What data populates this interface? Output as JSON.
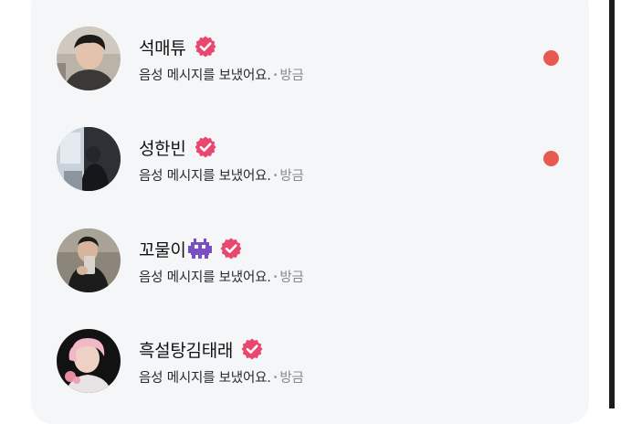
{
  "colors": {
    "panel_bg": "#f5f6f8",
    "verified_badge": "#e8486f",
    "unread_dot": "#e85a4f",
    "name_text": "#111111",
    "message_text": "#2a2a2a",
    "time_text": "#8a8a8a"
  },
  "conversations": [
    {
      "name": "석매튜",
      "verified": true,
      "message": "음성 메시지를 보냈어요.",
      "separator": "•",
      "time": "방금",
      "unread": true,
      "avatar_icon": "profile-photo-icon"
    },
    {
      "name": "성한빈",
      "verified": true,
      "message": "음성 메시지를 보냈어요.",
      "separator": "•",
      "time": "방금",
      "unread": true,
      "avatar_icon": "profile-photo-icon"
    },
    {
      "name": "꼬물이",
      "emoji": "alien-monster-emoji",
      "verified": true,
      "message": "음성 메시지를 보냈어요.",
      "separator": "•",
      "time": "방금",
      "unread": false,
      "avatar_icon": "profile-photo-icon"
    },
    {
      "name": "흑설탕김태래",
      "verified": true,
      "message": "음성 메시지를 보냈어요.",
      "separator": "•",
      "time": "방금",
      "unread": false,
      "avatar_icon": "profile-photo-icon"
    }
  ]
}
